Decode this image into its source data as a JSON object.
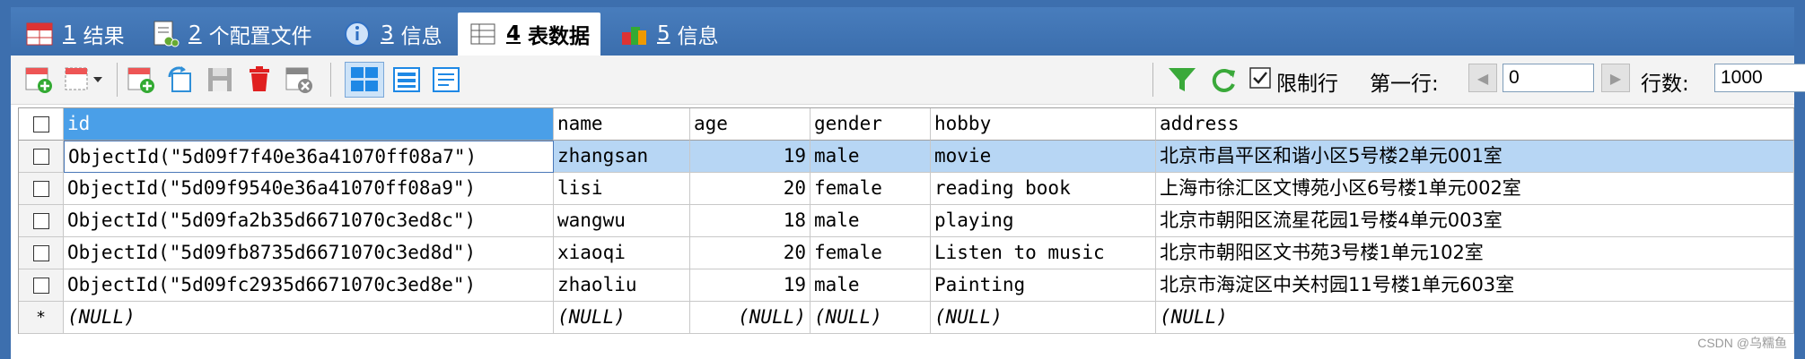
{
  "tabs": [
    {
      "num": "1",
      "label": "结果",
      "active": false
    },
    {
      "num": "2",
      "label": "个配置文件",
      "active": false
    },
    {
      "num": "3",
      "label": "信息",
      "active": false
    },
    {
      "num": "4",
      "label": "表数据",
      "active": true
    },
    {
      "num": "5",
      "label": "信息",
      "active": false
    }
  ],
  "toolbar": {
    "limit_rows_label": "限制行",
    "limit_rows_checked": true,
    "first_row_label": "第一行:",
    "first_row_value": "0",
    "row_count_label": "行数:",
    "row_count_value": "1000",
    "prev_icon": "prev-page-icon",
    "next_icon": "next-page-icon"
  },
  "grid": {
    "columns": [
      "id",
      "name",
      "age",
      "gender",
      "hobby",
      "address"
    ],
    "rows": [
      [
        "ObjectId(\"5d09f7f40e36a41070ff08a7\")",
        "zhangsan",
        "19",
        "male",
        "movie",
        "北京市昌平区和谐小区5号楼2单元001室"
      ],
      [
        "ObjectId(\"5d09f9540e36a41070ff08a9\")",
        "lisi",
        "20",
        "female",
        "reading book",
        "上海市徐汇区文博苑小区6号楼1单元002室"
      ],
      [
        "ObjectId(\"5d09fa2b35d6671070c3ed8c\")",
        "wangwu",
        "18",
        "male",
        "playing",
        "北京市朝阳区流星花园1号楼4单元003室"
      ],
      [
        "ObjectId(\"5d09fb8735d6671070c3ed8d\")",
        "xiaoqi",
        "20",
        "female",
        "Listen to music",
        "北京市朝阳区文书苑3号楼1单元102室"
      ],
      [
        "ObjectId(\"5d09fc2935d6671070c3ed8e\")",
        "zhaoliu",
        "19",
        "male",
        "Painting",
        "北京市海淀区中关村园11号楼1单元603室"
      ]
    ],
    "new_row_marker": "*",
    "null_text": "(NULL)"
  },
  "colors": {
    "frame": "#3d6fae",
    "selected_header": "#4a9fe8",
    "selected_row": "#b7d6f4"
  },
  "watermark": "CSDN @乌糯鱼"
}
